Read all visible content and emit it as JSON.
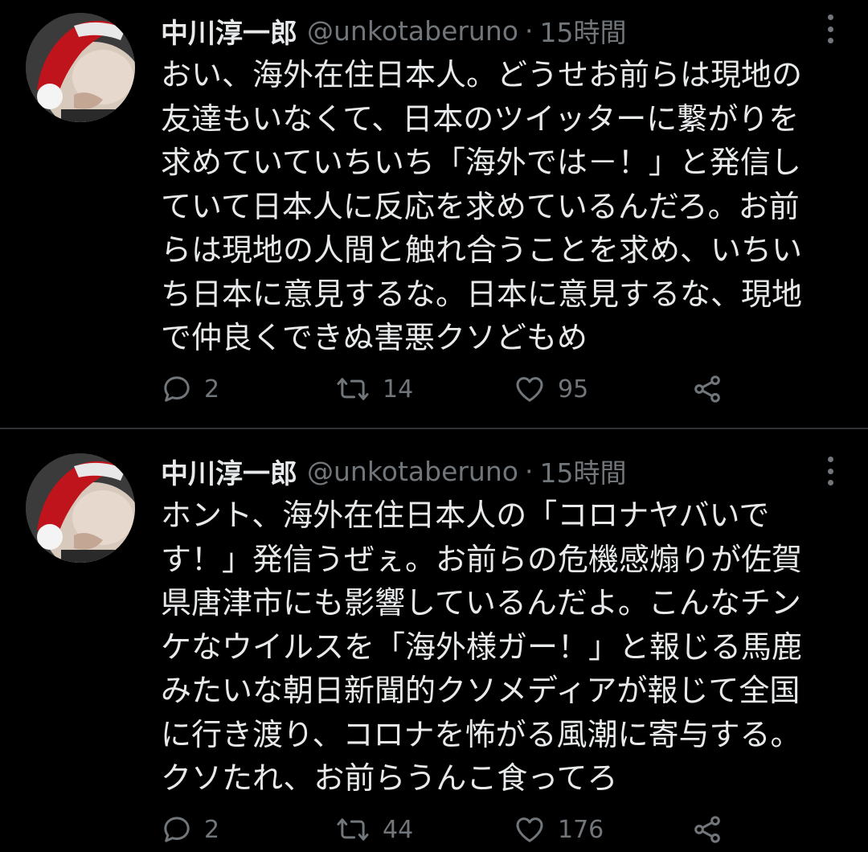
{
  "tweets": [
    {
      "display_name": "中川淳一郎",
      "handle": "@unkotaberuno",
      "separator": "·",
      "time": "15時間",
      "text": "おい、海外在住日本人。どうせお前らは現地の\n友達もいなくて、日本のツイッターに繋がりを\n求めていていちいち「海外では－！」と発信し\nていて日本人に反応を求めているんだろ。お前\nらは現地の人間と触れ合うことを求め、いちい\nち日本に意見するな。日本に意見するな、現地\nで仲良くできぬ害悪クソどもめ",
      "replies": "2",
      "retweets": "14",
      "likes": "95"
    },
    {
      "display_name": "中川淳一郎",
      "handle": "@unkotaberuno",
      "separator": "·",
      "time": "15時間",
      "text": "ホント、海外在住日本人の「コロナヤバいで\nす！」発信うぜぇ。お前らの危機感煽りが佐賀\n県唐津市にも影響しているんだよ。こんなチン\nケなウイルスを「海外様ガー！」と報じる馬鹿\nみたいな朝日新聞的クソメディアが報じて全国\nに行き渡り、コロナを怖がる風潮に寄与する。\nクソたれ、お前らうんこ食ってろ",
      "replies": "2",
      "retweets": "44",
      "likes": "176"
    }
  ],
  "icons": {
    "reply": "speech-bubble-icon",
    "retweet": "retweet-arrows-icon",
    "like": "heart-outline-icon",
    "share": "share-nodes-icon",
    "more": "vertical-dots-icon"
  },
  "colors": {
    "background": "#000000",
    "text": "#e7e9ea",
    "secondary": "#71767b",
    "divider": "#2f3336",
    "santa_hat_red": "#c0141c"
  }
}
